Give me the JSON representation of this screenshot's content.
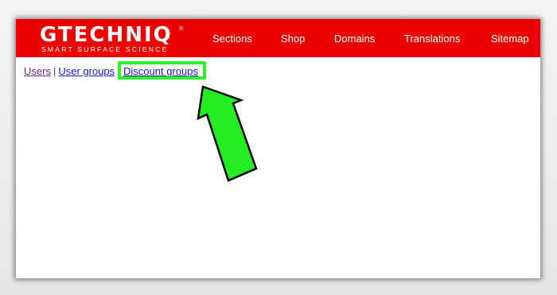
{
  "header": {
    "logo_text": "GTECHNIQ",
    "logo_reg": "®",
    "logo_tagline": "SMART SURFACE SCIENCE",
    "nav": [
      "Sections",
      "Shop",
      "Domains",
      "Translations",
      "Sitemap"
    ]
  },
  "breadcrumbs": {
    "users": "Users",
    "separator": "|",
    "user_groups": "User groups",
    "discount_groups": "Discount groups"
  },
  "annotation": {
    "highlight_color": "#2bf02b",
    "arrow_color": "#22ee22"
  },
  "colors": {
    "header_bg": "#ee0000",
    "link": "#1a1acc",
    "link_visited": "#6b2b8c"
  }
}
